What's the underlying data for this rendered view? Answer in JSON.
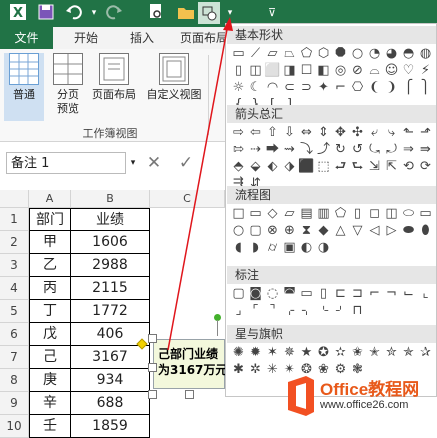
{
  "qat": {
    "icons": [
      "excel-logo-icon",
      "save-icon",
      "undo-icon",
      "redo-icon",
      "print-preview-icon",
      "open-icon",
      "shapes-icon",
      "customize-icon"
    ]
  },
  "tabs": [
    {
      "label": "文件"
    },
    {
      "label": "开始"
    },
    {
      "label": "插入"
    },
    {
      "label": "页面布局"
    }
  ],
  "ribbon": {
    "buttons": [
      {
        "label": "普通"
      },
      {
        "label": "分页\n预览"
      },
      {
        "label": "页面布局"
      },
      {
        "label": "自定义视图"
      }
    ],
    "group_label": "工作簿视图"
  },
  "formula_bar": {
    "name_box": "备注 1",
    "cancel": "✕",
    "confirm": "✓"
  },
  "sheet": {
    "columns": [
      "A",
      "B",
      "C"
    ],
    "rows": [
      "1",
      "2",
      "3",
      "4",
      "5",
      "6",
      "7",
      "8",
      "9",
      "10"
    ],
    "header": [
      "部门",
      "业绩"
    ],
    "data": [
      [
        "甲",
        "1606"
      ],
      [
        "乙",
        "2988"
      ],
      [
        "丙",
        "2115"
      ],
      [
        "丁",
        "1772"
      ],
      [
        "戊",
        "406"
      ],
      [
        "己",
        "3167"
      ],
      [
        "庚",
        "934"
      ],
      [
        "辛",
        "688"
      ],
      [
        "壬",
        "1859"
      ]
    ]
  },
  "callout": {
    "line1": "己部门业绩",
    "line2": "为3167万元"
  },
  "shapes_panel": {
    "sections": [
      {
        "title": "基本形状"
      },
      {
        "title": "箭头总汇"
      },
      {
        "title": "流程图"
      },
      {
        "title": "标注"
      },
      {
        "title": "星与旗帜"
      }
    ]
  },
  "watermark": {
    "brand": "Office教程网",
    "url": "www.office26.com"
  },
  "colors": {
    "excel_green": "#217346",
    "annotation_red": "#e0161c",
    "logo_orange": "#f25022"
  }
}
